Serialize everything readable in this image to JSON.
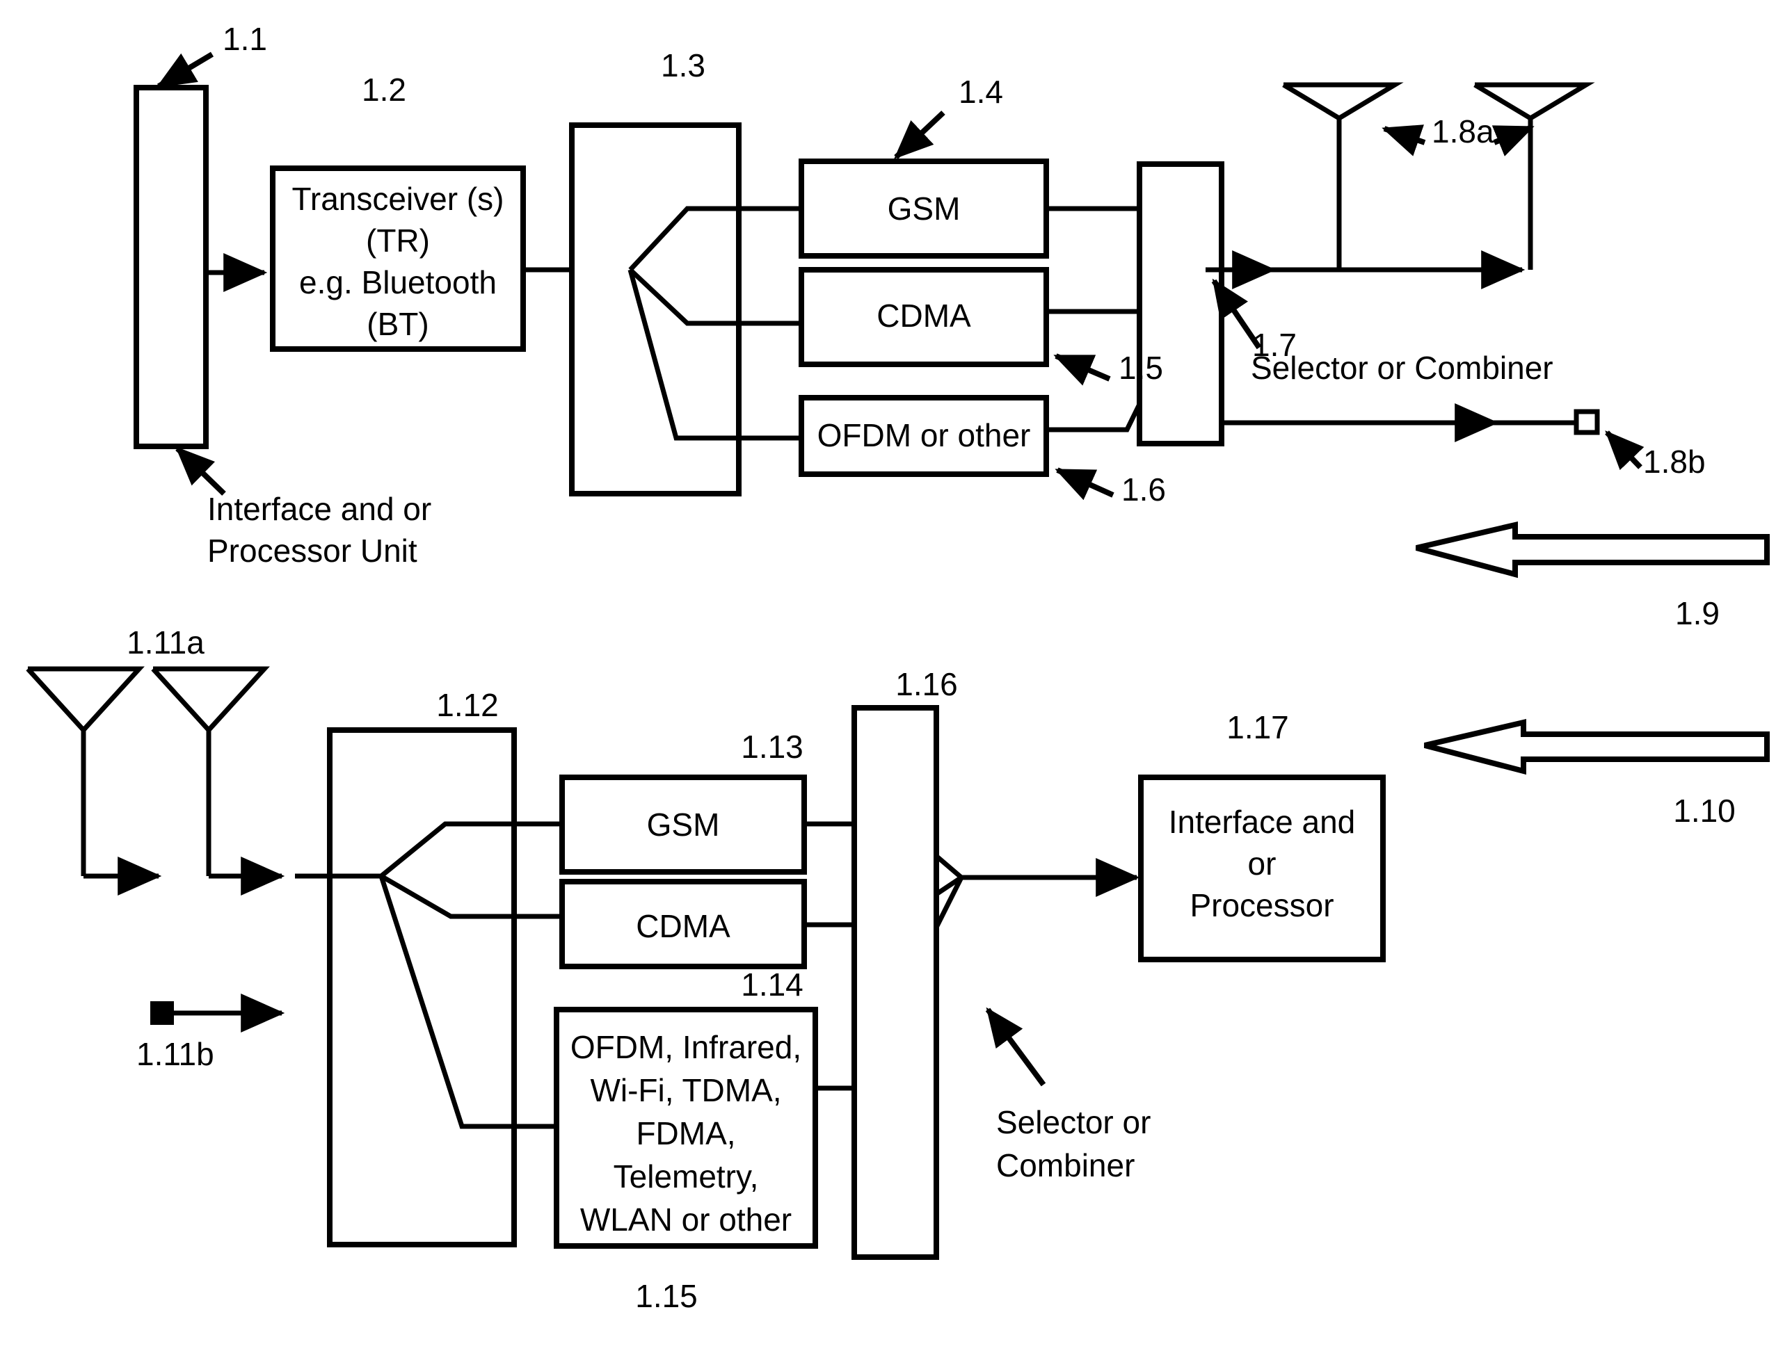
{
  "figure": {
    "type": "patent-block-diagram",
    "title": "",
    "background_color": "#ffffff",
    "line_color": "#000000"
  },
  "transmit_chain": {
    "interface_unit": {
      "ref": "1.1",
      "caption_line1": "Interface and or",
      "caption_line2": "Processor Unit"
    },
    "transceiver": {
      "ref": "1.2",
      "line1": "Transceiver (s)",
      "line2": "(TR)",
      "line3": "e.g. Bluetooth",
      "line4": "(BT)"
    },
    "splitter": {
      "ref": "1.3"
    },
    "modems": [
      {
        "ref": "1.4",
        "label": "GSM"
      },
      {
        "ref": "1.5",
        "label": "CDMA"
      },
      {
        "ref": "1.6",
        "label": "OFDM or other"
      }
    ],
    "combiner": {
      "ref": "1.7",
      "caption": "Selector or Combiner"
    },
    "outputs": [
      {
        "ref": "1.8a",
        "kind": "antenna-pair"
      },
      {
        "ref": "1.8b",
        "kind": "open-square-terminal"
      }
    ],
    "direction_arrow": {
      "ref": "1.9",
      "direction": "left"
    }
  },
  "receive_chain": {
    "inputs": [
      {
        "ref": "1.11a",
        "kind": "antenna-pair"
      },
      {
        "ref": "1.11b",
        "kind": "filled-square-terminal"
      }
    ],
    "splitter": {
      "ref": "1.12"
    },
    "modems": [
      {
        "ref": "1.13",
        "label": "GSM"
      },
      {
        "ref": "1.14",
        "label": "CDMA"
      },
      {
        "ref": "1.15",
        "label_line1": "OFDM, Infrared,",
        "label_line2": "Wi-Fi, TDMA,",
        "label_line3": "FDMA,",
        "label_line4": "Telemetry,",
        "label_line5": "WLAN or other"
      }
    ],
    "combiner": {
      "ref": "1.16",
      "caption_line1": "Selector or",
      "caption_line2": "Combiner"
    },
    "processor": {
      "ref": "1.17",
      "line1": "Interface and",
      "line2": "or",
      "line3": "Processor"
    },
    "direction_arrow": {
      "ref": "1.10",
      "direction": "left"
    }
  }
}
